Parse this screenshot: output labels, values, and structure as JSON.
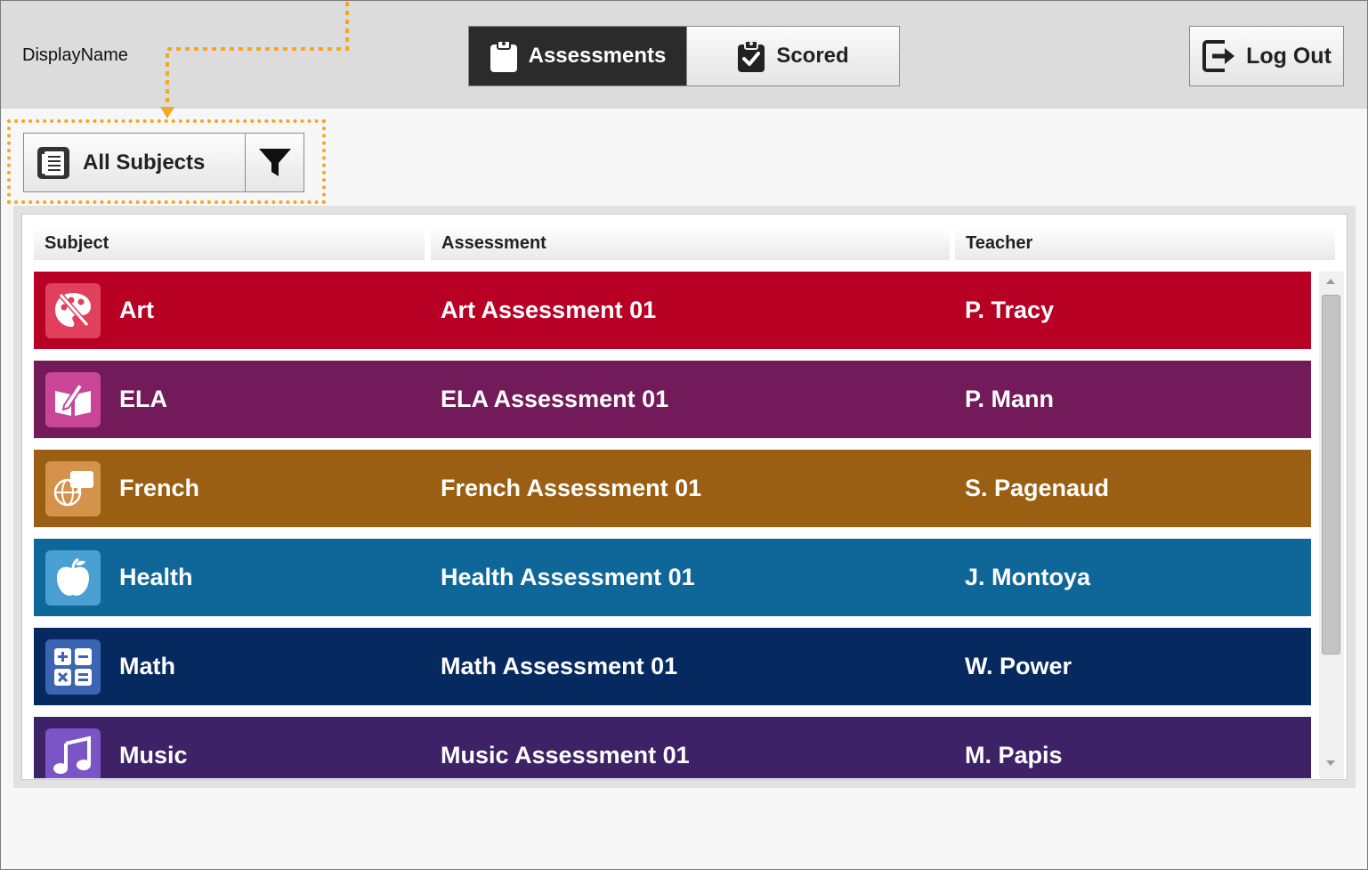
{
  "header": {
    "display_name": "DisplayName",
    "tabs": [
      {
        "label": "Assessments",
        "icon": "clipboard-icon",
        "active": true
      },
      {
        "label": "Scored",
        "icon": "clipboard-check-icon",
        "active": false
      }
    ],
    "logout_label": "Log Out"
  },
  "filter": {
    "label": "All Subjects",
    "icon": "list-document-icon",
    "button_icon": "funnel-icon"
  },
  "annotation": {
    "color": "#f5a623"
  },
  "table": {
    "columns": [
      "Subject",
      "Assessment",
      "Teacher"
    ],
    "rows": [
      {
        "subject": "Art",
        "assessment": "Art Assessment 01",
        "teacher": "P. Tracy",
        "color": "#b80024",
        "icon_color": "#e0405e",
        "icon": "palette-brush-icon"
      },
      {
        "subject": "ELA",
        "assessment": "ELA Assessment 01",
        "teacher": "P. Mann",
        "color": "#731a5a",
        "icon_color": "#c84598",
        "icon": "book-pencil-icon"
      },
      {
        "subject": "French",
        "assessment": "French Assessment 01",
        "teacher": "S. Pagenaud",
        "color": "#9a5f12",
        "icon_color": "#d4924a",
        "icon": "globe-speech-icon"
      },
      {
        "subject": "Health",
        "assessment": "Health Assessment 01",
        "teacher": "J. Montoya",
        "color": "#0e6798",
        "icon_color": "#4aa0d2",
        "icon": "apple-icon"
      },
      {
        "subject": "Math",
        "assessment": "Math Assessment 01",
        "teacher": "W. Power",
        "color": "#062a60",
        "icon_color": "#3b64b2",
        "icon": "calculator-icon"
      },
      {
        "subject": "Music",
        "assessment": "Music Assessment 01",
        "teacher": "M. Papis",
        "color": "#3d2268",
        "icon_color": "#7b55c6",
        "icon": "music-note-icon"
      }
    ]
  }
}
